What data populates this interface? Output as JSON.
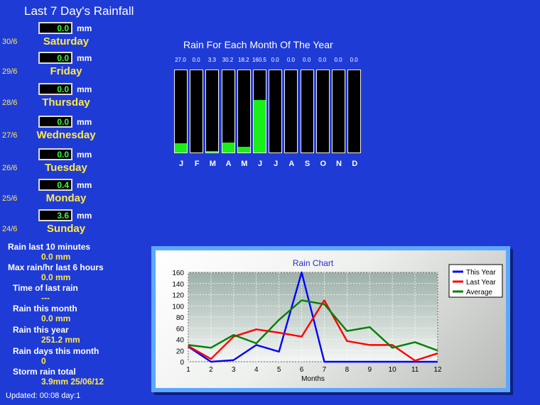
{
  "header": {
    "title": "Last 7 Day's Rainfall"
  },
  "days": [
    {
      "date": "30/6",
      "value": "0.0",
      "unit": "mm",
      "name": "Saturday"
    },
    {
      "date": "29/6",
      "value": "0.0",
      "unit": "mm",
      "name": "Friday"
    },
    {
      "date": "28/6",
      "value": "0.0",
      "unit": "mm",
      "name": "Thursday"
    },
    {
      "date": "27/6",
      "value": "0.0",
      "unit": "mm",
      "name": "Wednesday"
    },
    {
      "date": "26/6",
      "value": "0.0",
      "unit": "mm",
      "name": "Tuesday"
    },
    {
      "date": "25/6",
      "value": "0.4",
      "unit": "mm",
      "name": "Monday"
    },
    {
      "date": "24/6",
      "value": "3.6",
      "unit": "mm",
      "name": "Sunday"
    }
  ],
  "stats": [
    {
      "label": "Rain last 10 minutes",
      "value": "0.0 mm"
    },
    {
      "label": "Max rain/hr last 6 hours",
      "value": "0.0 mm"
    },
    {
      "label": "Time of last rain",
      "value": "---"
    },
    {
      "label": "Rain this month",
      "value": "0.0 mm"
    },
    {
      "label": "Rain this year",
      "value": "251.2 mm"
    },
    {
      "label": "Rain days this month",
      "value": "0"
    },
    {
      "label": "Storm rain total",
      "value": "3.9mm 25/06/12"
    }
  ],
  "updated": "Updated: 00:08 day:1",
  "monthly": {
    "title": "Rain For Each Month Of The Year",
    "value_labels": [
      "27.0",
      "0.0",
      "3.3",
      "30.2",
      "18.2",
      "160.5",
      "0.0",
      "0.0",
      "0.0",
      "0.0",
      "0.0",
      "0.0"
    ],
    "letters": [
      "J",
      "F",
      "M",
      "A",
      "M",
      "J",
      "J",
      "A",
      "S",
      "O",
      "N",
      "D"
    ],
    "values": [
      27.0,
      0.0,
      3.3,
      30.2,
      18.2,
      160.5,
      0,
      0,
      0,
      0,
      0,
      0
    ],
    "max": 250,
    "bar_color": "#18f018"
  },
  "chart_data": {
    "type": "line",
    "title": "Rain Chart",
    "xlabel": "Months",
    "ylabel": "",
    "x": [
      1,
      2,
      3,
      4,
      5,
      6,
      7,
      8,
      9,
      10,
      11,
      12
    ],
    "ylim": [
      0,
      160
    ],
    "yticks": [
      0,
      20,
      40,
      60,
      80,
      100,
      120,
      140,
      160
    ],
    "grid": true,
    "legend": "top-right",
    "series": [
      {
        "name": "This Year",
        "color": "#0000ff",
        "values": [
          27,
          0,
          3,
          30,
          18,
          160,
          0,
          0,
          0,
          0,
          0,
          0
        ]
      },
      {
        "name": "Last Year",
        "color": "#ff0000",
        "values": [
          28,
          5,
          45,
          58,
          52,
          45,
          110,
          37,
          30,
          30,
          2,
          15
        ]
      },
      {
        "name": "Average",
        "color": "#008000",
        "values": [
          30,
          25,
          48,
          33,
          75,
          110,
          103,
          55,
          62,
          25,
          35,
          20
        ]
      }
    ]
  }
}
